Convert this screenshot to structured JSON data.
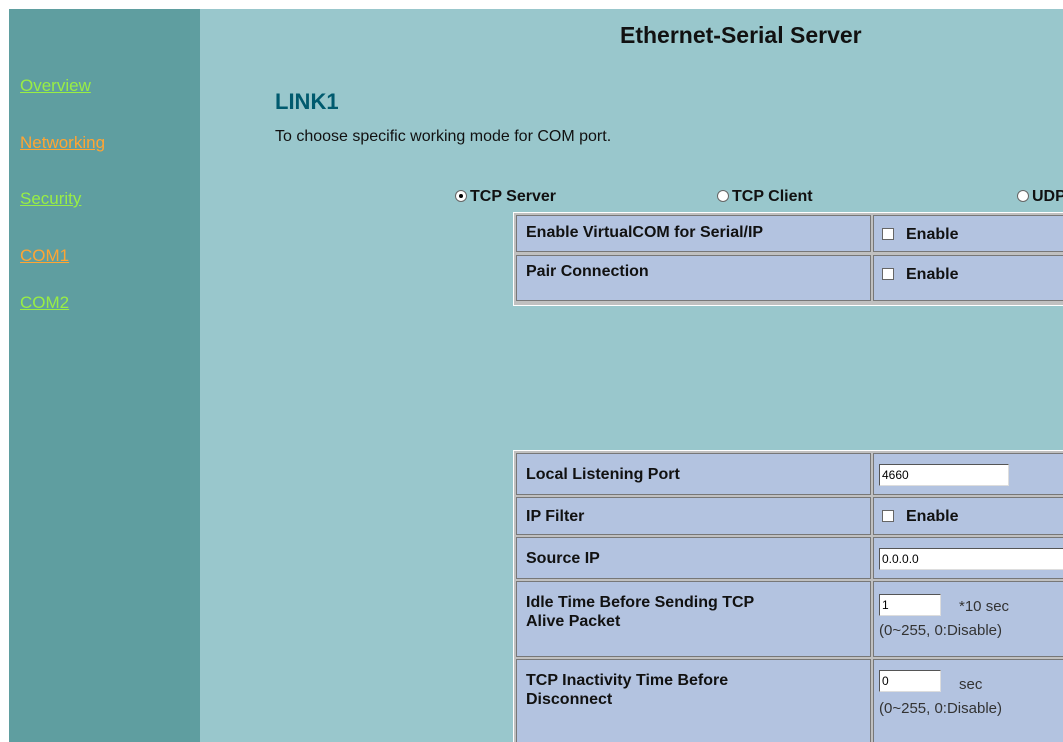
{
  "sidebar": {
    "items": [
      {
        "label": "Overview"
      },
      {
        "label": "Networking"
      },
      {
        "label": "Security"
      },
      {
        "label": "COM1"
      },
      {
        "label": "COM2"
      }
    ]
  },
  "header": {
    "title": "Ethernet-Serial Server"
  },
  "page": {
    "title": "LINK1",
    "description": "To choose specific working mode for COM port."
  },
  "modes": {
    "selected": "TCP Server",
    "options": [
      "TCP Server",
      "TCP Client",
      "UDP"
    ]
  },
  "virtual_table": {
    "rows": [
      {
        "label": "Enable VirtualCOM for Serial/IP",
        "value": "Enable",
        "checked": false
      },
      {
        "label": "Pair Connection",
        "value": "Enable",
        "checked": false
      }
    ]
  },
  "settings": {
    "local_port": {
      "label": "Local Listening Port",
      "value": "4660"
    },
    "ip_filter": {
      "label": "IP Filter",
      "value": "Enable",
      "checked": false
    },
    "source_ip": {
      "label": "Source IP",
      "value": "0.0.0.0"
    },
    "idle_time": {
      "label_line1": "Idle Time Before Sending TCP",
      "label_line2": "Alive Packet",
      "value": "1",
      "unit": "*10 sec",
      "range": "(0~255, 0:Disable)"
    },
    "inactivity": {
      "label_line1": "TCP Inactivity Time Before",
      "label_line2": "Disconnect",
      "value": "0",
      "unit": "sec",
      "range": "(0~255, 0:Disable)"
    }
  },
  "colors": {
    "sidebar_bg": "#5f9ea0",
    "main_bg": "#99c7cc",
    "nav_active": "#ffa533",
    "nav_link": "#99ee44",
    "title": "#005a6e",
    "table_cell": "#b3c3e0"
  }
}
